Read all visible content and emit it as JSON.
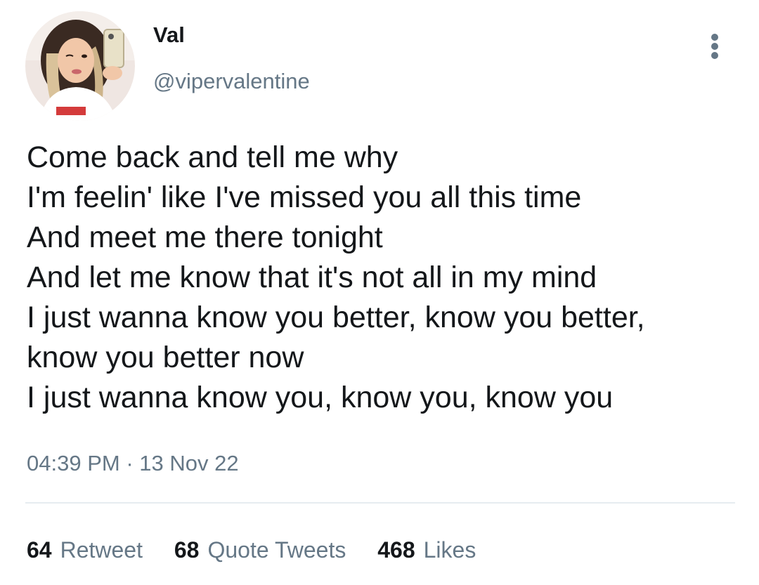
{
  "author": {
    "display_name": "Val",
    "handle": "@vipervalentine",
    "avatar_icon": "profile-photo"
  },
  "tweet": {
    "lines": [
      "Come back and tell me why",
      "I'm feelin' like I've missed you all this time",
      "And meet me there tonight",
      "And let me know that it's not all in my mind",
      "I just wanna know you better, know you better,",
      "know you better now",
      "I just wanna know you, know you, know you"
    ],
    "time": "04:39 PM",
    "separator": "·",
    "date": "13 Nov 22"
  },
  "stats": {
    "retweet_count": "64",
    "retweet_label": "Retweet",
    "quote_count": "68",
    "quote_label": "Quote Tweets",
    "likes_count": "468",
    "likes_label": "Likes"
  },
  "colors": {
    "text_primary": "#14171a",
    "text_secondary": "#657786",
    "divider": "#e6ecf0"
  },
  "icons": {
    "more": "more-vertical-icon"
  }
}
